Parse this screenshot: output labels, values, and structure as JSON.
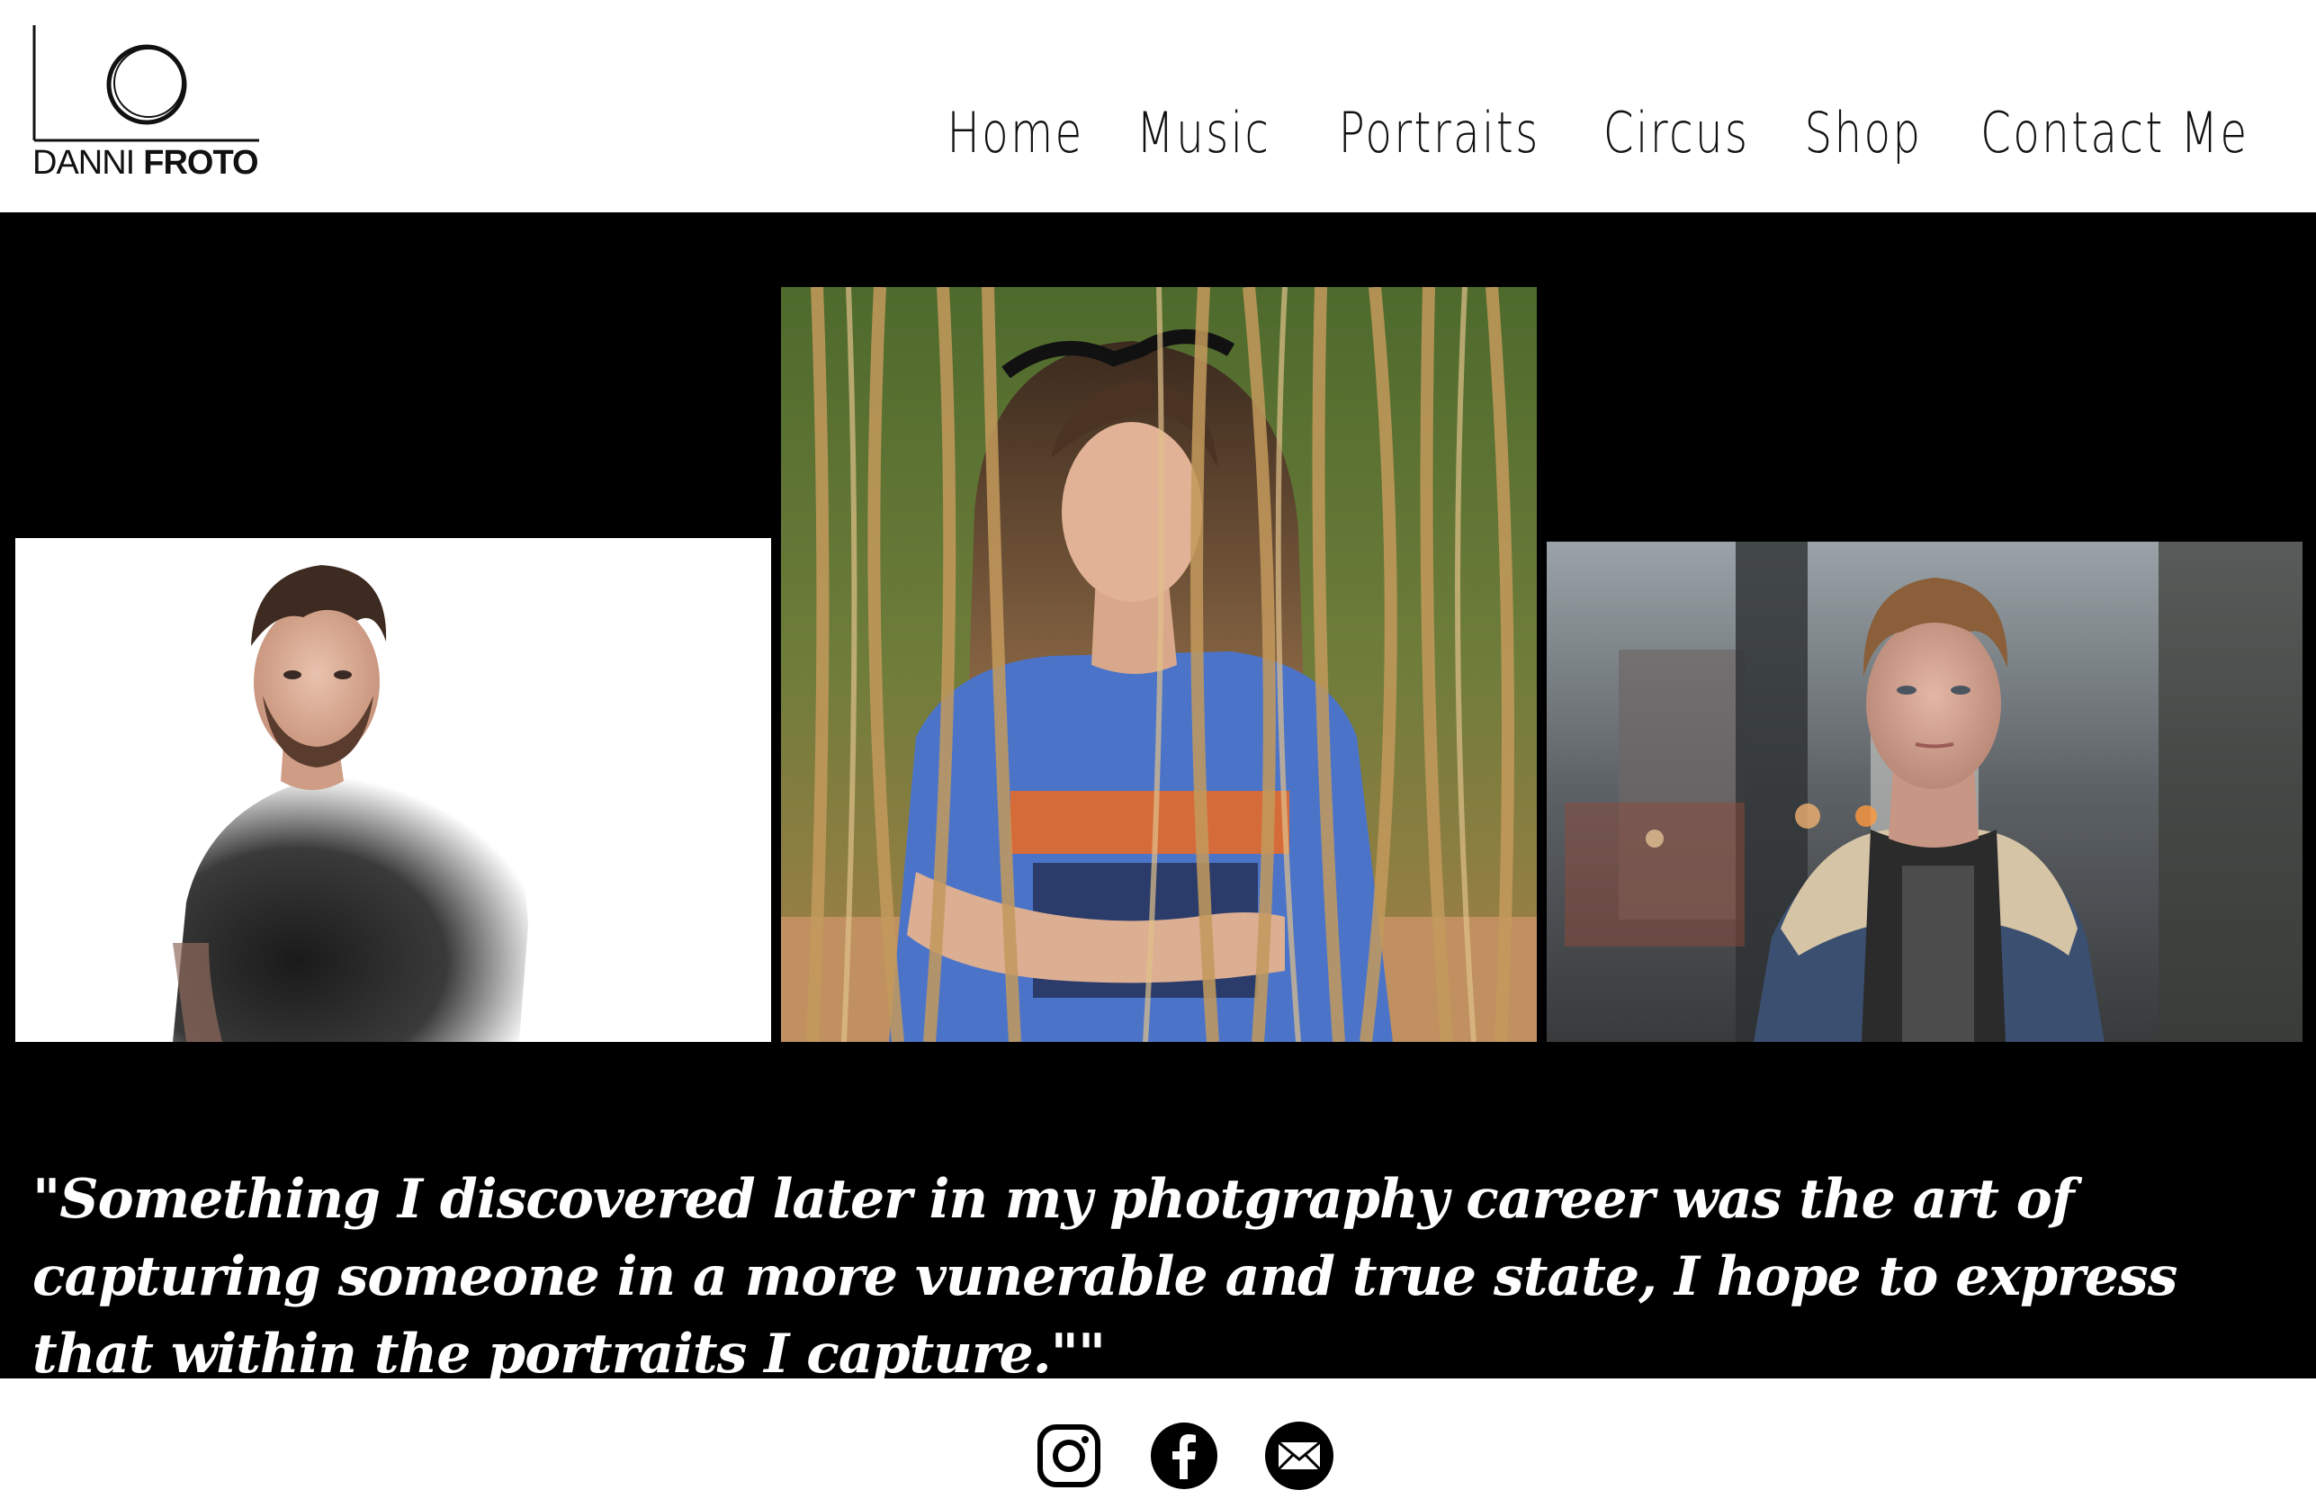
{
  "logo": {
    "first_name": "DANNI",
    "last_name": "FROTO"
  },
  "nav": {
    "items": [
      "Home",
      "Music",
      "Portraits",
      "Circus",
      "Shop",
      "Contact Me"
    ]
  },
  "gallery": {
    "photos": [
      {
        "subject": "portrait-man-black-tshirt"
      },
      {
        "subject": "portrait-woman-blue-tshirt-reeds"
      },
      {
        "subject": "portrait-man-denim-jacket-street"
      }
    ]
  },
  "quote": {
    "text": "\"Something I discovered later in my photgraphy career was the art of capturing someone in a more vunerable and true state, I hope to express that within the portraits I capture.\"\""
  },
  "social": {
    "icons": [
      "instagram-icon",
      "facebook-icon",
      "email-icon"
    ]
  },
  "colors": {
    "header_bg": "#ffffff",
    "main_bg": "#000000",
    "text_dark": "#111111",
    "quote_text": "#ffffff"
  }
}
